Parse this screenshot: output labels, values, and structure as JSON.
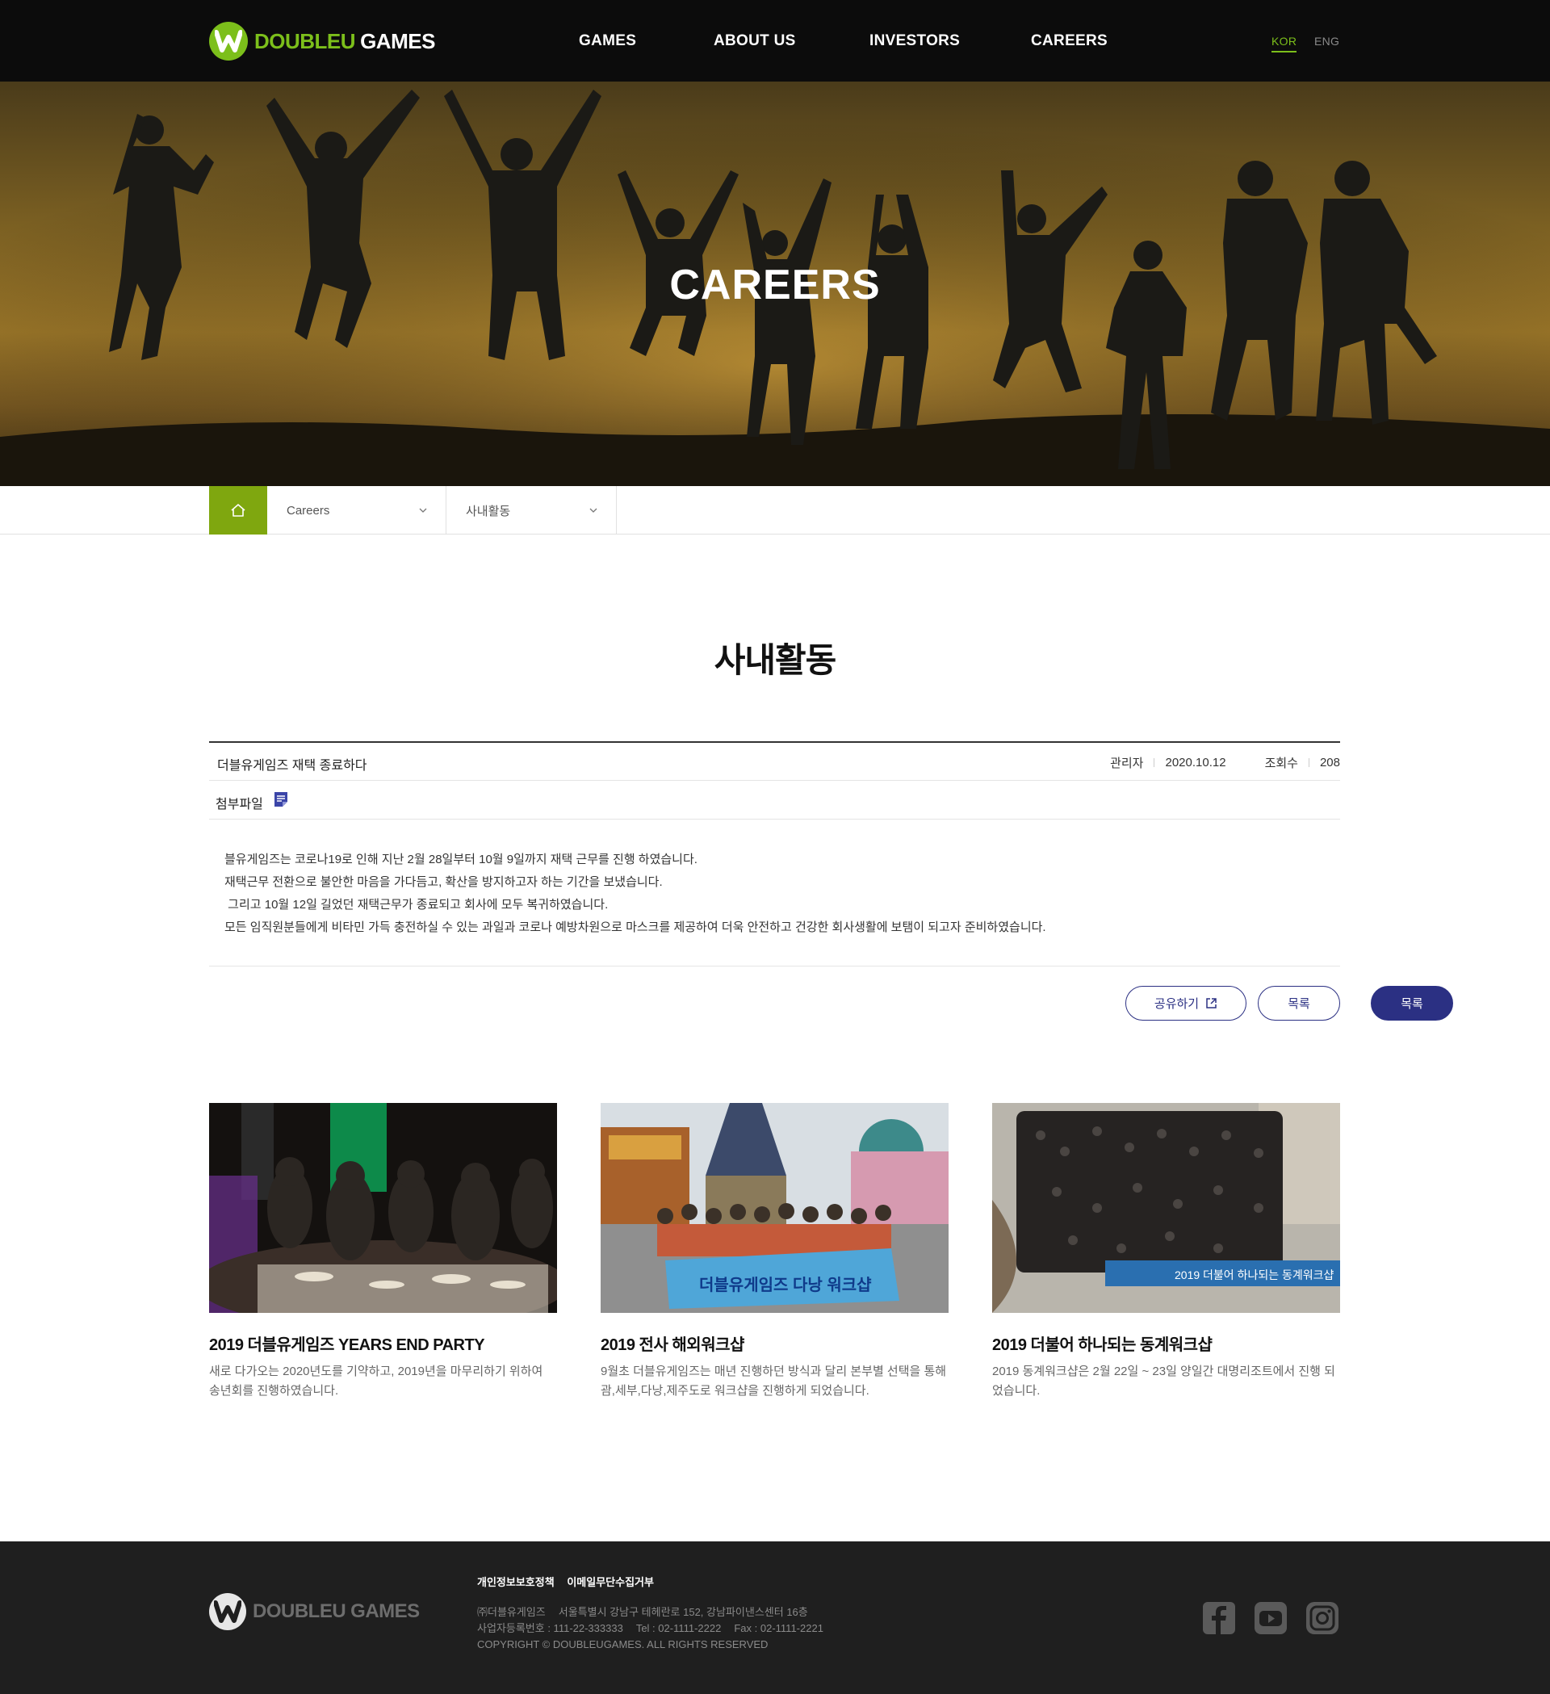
{
  "header": {
    "logo": {
      "brand": "DOUBLEU",
      "brand2": "GAMES"
    },
    "nav": [
      "GAMES",
      "ABOUT US",
      "INVESTORS",
      "CAREERS"
    ],
    "lang": {
      "kor": "KOR",
      "eng": "ENG"
    }
  },
  "hero": {
    "title": "CAREERS"
  },
  "breadcrumb": {
    "level1": "Careers",
    "level2": "사내활동"
  },
  "page": {
    "title": "사내활동"
  },
  "post": {
    "title": "더블유게임즈 재택 종료하다",
    "author": "관리자",
    "date": "2020.10.12",
    "views_label": "조회수",
    "views": "208",
    "attach_label": "첨부파일",
    "body": [
      "블유게임즈는 코로나19로 인해 지난 2월 28일부터 10월 9일까지 재택 근무를 진행 하였습니다.",
      "재택근무 전환으로 불안한 마음을 가다듬고, 확산을 방지하고자 하는 기간을 보냈습니다.",
      " 그리고 10월 12일 길었던 재택근무가 종료되고 회사에 모두 복귀하였습니다.",
      "모든 임직원분들에게 비타민 가득 충전하실 수 있는 과일과 코로나 예방차원으로 마스크를 제공하여 더욱 안전하고 건강한 회사생활에 보탬이 되고자 준비하였습니다."
    ]
  },
  "buttons": {
    "share": "공유하기",
    "list": "목록",
    "list2": "목록"
  },
  "cards": [
    {
      "title": "2019 더블유게임즈 YEARS END PARTY",
      "desc": "새로 다가오는 2020년도를 기약하고, 2019년을 마무리하기 위하여 송년회를 진행하였습니다."
    },
    {
      "title": "2019 전사 해외워크샵",
      "desc": "9월초 더블유게임즈는 매년 진행하던 방식과 달리 본부별 선택을 통해 괌,세부,다낭,제주도로 워크샵을 진행하게 되었습니다.",
      "banner": "더블유게임즈 다낭 워크샵"
    },
    {
      "title": "2019 더불어 하나되는 동계워크샵",
      "desc": "2019 동계워크샵은 2월 22일 ~ 23일 양일간 대명리조트에서 진행 되었습니다.",
      "banner": "2019 더불어 하나되는 동계워크샵"
    }
  ],
  "footer": {
    "links": [
      "개인정보보호정책",
      "이메일무단수집거부"
    ],
    "company": "㈜더블유게임즈",
    "address": "서울특별시 강남구 테헤란로 152, 강남파이낸스센터 16층",
    "bizno": "사업자등록번호 : 111-22-333333",
    "tel": "Tel : 02-1111-2222",
    "fax": "Fax : 02-1111-2221",
    "copyright": "COPYRIGHT © DOUBLEUGAMES. ALL RIGHTS RESERVED"
  },
  "colors": {
    "accent": "#7cbf1b",
    "home": "#7fa70f",
    "button": "#2b3083"
  },
  "icons": [
    "home-icon",
    "chevron-down-icon",
    "file-icon",
    "external-link-icon",
    "facebook-icon",
    "youtube-icon",
    "instagram-icon"
  ]
}
